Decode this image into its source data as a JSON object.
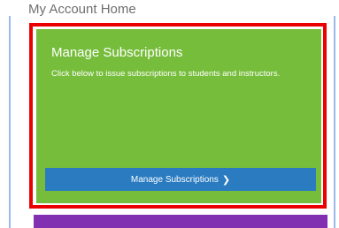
{
  "page": {
    "title": "My Account Home"
  },
  "card": {
    "title": "Manage Subscriptions",
    "description": "Click below to issue subscriptions to students and instructors.",
    "button_label": "Manage Subscriptions",
    "button_icon": "chevron-right-icon"
  },
  "colors": {
    "card_green": "#77bd3c",
    "button_blue": "#2a7bc0",
    "highlight_red": "#ea0000",
    "next_card_purple": "#8130b2"
  }
}
